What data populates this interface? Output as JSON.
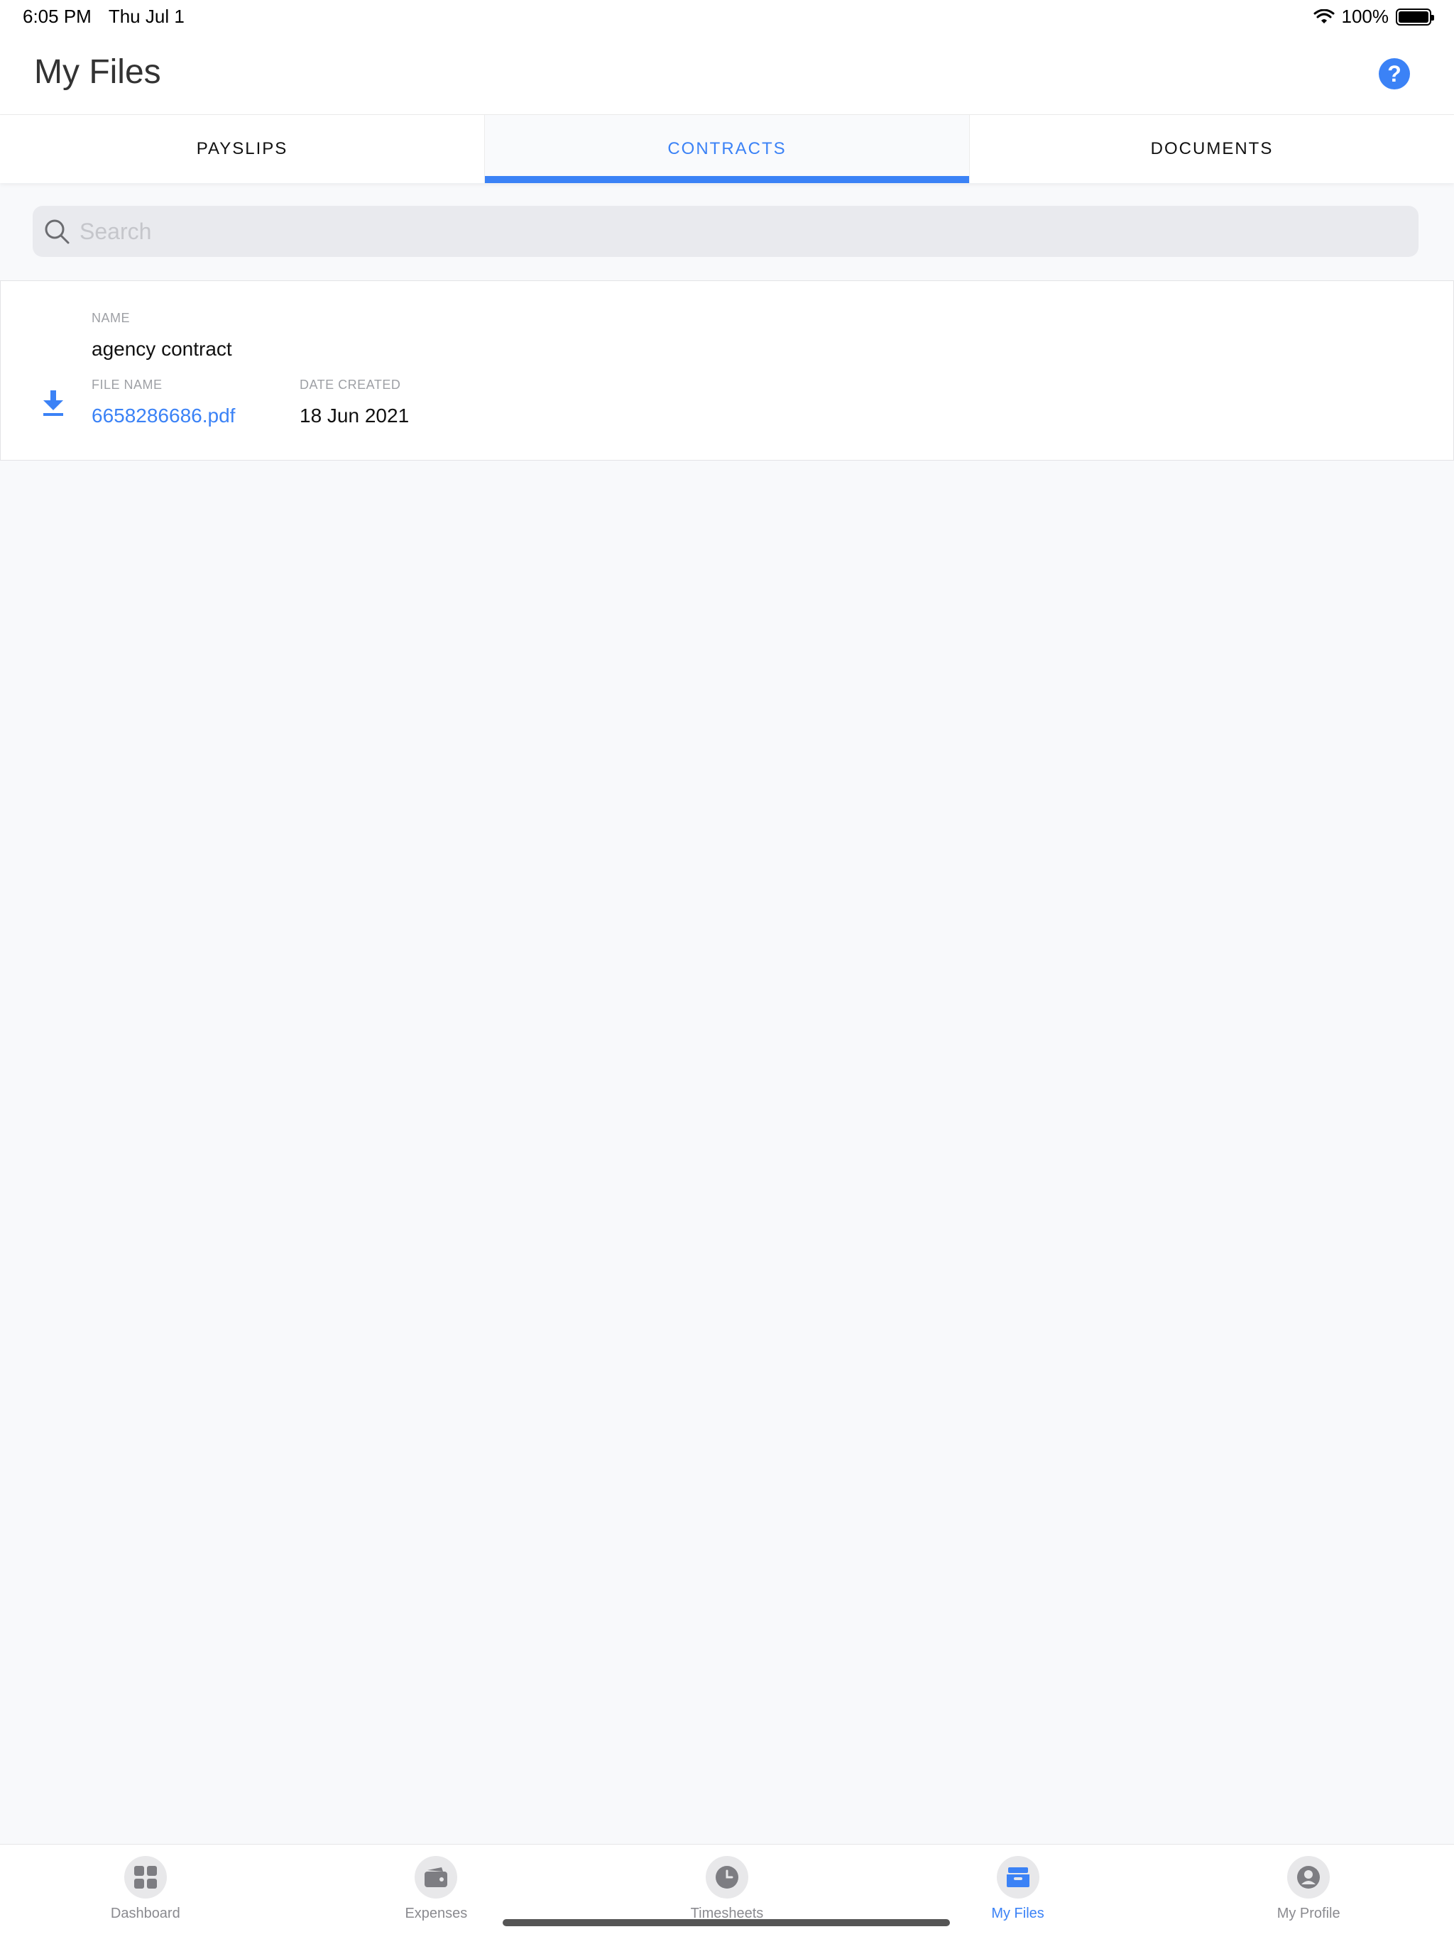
{
  "status_bar": {
    "time": "6:05 PM",
    "date": "Thu Jul 1",
    "battery": "100%"
  },
  "header": {
    "title": "My Files",
    "help_label": "?"
  },
  "tabs": [
    {
      "label": "PAYSLIPS",
      "active": false
    },
    {
      "label": "CONTRACTS",
      "active": true
    },
    {
      "label": "DOCUMENTS",
      "active": false
    }
  ],
  "search": {
    "placeholder": "Search",
    "value": ""
  },
  "file": {
    "name_label": "NAME",
    "name": "agency contract",
    "file_name_label": "FILE NAME",
    "file_name": "6658286686.pdf",
    "date_created_label": "DATE CREATED",
    "date_created": "18 Jun 2021"
  },
  "nav": [
    {
      "label": "Dashboard",
      "icon": "grid-icon"
    },
    {
      "label": "Expenses",
      "icon": "wallet-icon"
    },
    {
      "label": "Timesheets",
      "icon": "clock-icon"
    },
    {
      "label": "My Files",
      "icon": "inbox-icon",
      "active": true
    },
    {
      "label": "My Profile",
      "icon": "person-icon"
    }
  ],
  "colors": {
    "accent": "#3b82f6",
    "background": "#f8f9fb",
    "muted": "#9ea0a5"
  }
}
